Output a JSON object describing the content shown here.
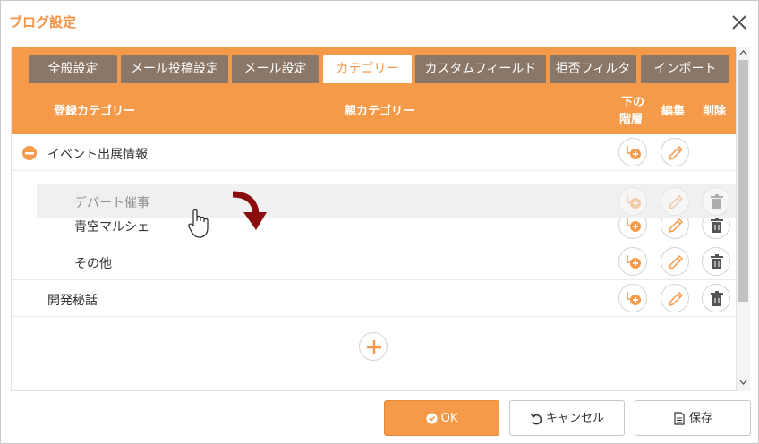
{
  "dialog": {
    "title": "ブログ設定"
  },
  "tabs": [
    {
      "label": "全般設定"
    },
    {
      "label": "メール投稿設定"
    },
    {
      "label": "メール設定"
    },
    {
      "label": "カテゴリー"
    },
    {
      "label": "カスタムフィールド"
    },
    {
      "label": "拒否フィルタ"
    },
    {
      "label": "インポート"
    }
  ],
  "active_tab": "カテゴリー",
  "table_header": {
    "registered": "登録カテゴリー",
    "parent": "親カテゴリー",
    "sub_level_line1": "下の",
    "sub_level_line2": "階層",
    "edit": "編集",
    "delete": "削除"
  },
  "categories": [
    {
      "label": "イベント出展情報"
    },
    {
      "label": "青空マルシェ"
    },
    {
      "label": "その他"
    },
    {
      "label": "開発秘話"
    }
  ],
  "dragging_item": {
    "label": "デパート催事"
  },
  "buttons": {
    "ok": "OK",
    "cancel": "キャンセル",
    "save": "保存"
  },
  "colors": {
    "accent": "#f59a48",
    "tab_inactive": "#8b7768",
    "drag_arrow": "#8b0e0e"
  }
}
